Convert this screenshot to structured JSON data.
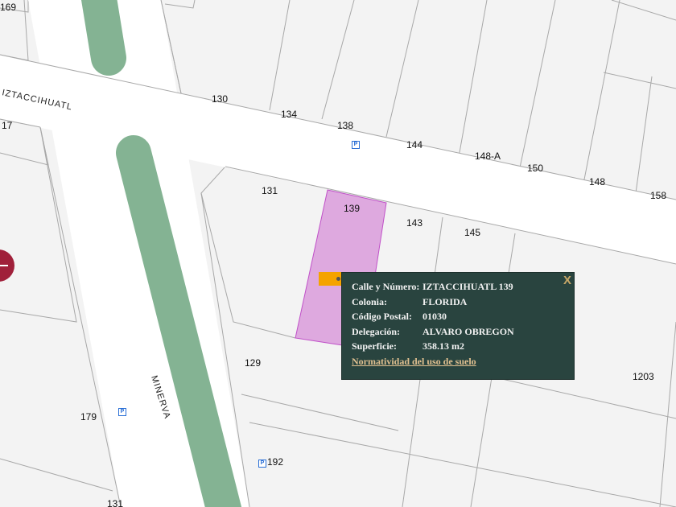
{
  "map": {
    "street_labels": {
      "iztaccihuatl": "IZTACCIHUATL",
      "minerva": "MINERVA"
    },
    "lot_numbers": [
      "169",
      "130",
      "134",
      "138",
      "144",
      "148-A",
      "150",
      "148",
      "158",
      "17",
      "131",
      "139",
      "143",
      "145",
      "129",
      "1203",
      "179",
      "192",
      "131"
    ],
    "selected_lot": "139",
    "colors": {
      "block": "#f3f3f3",
      "road": "#ffffff",
      "median": "#84b393",
      "selected": "#dea9df",
      "popup": "#29443f",
      "marker": "#f5a300"
    }
  },
  "popup": {
    "close_label": "X",
    "rows": [
      {
        "label": "Calle y Número:",
        "value": "IZTACCIHUATL 139"
      },
      {
        "label": "Colonia:",
        "value": "FLORIDA"
      },
      {
        "label": "Código Postal:",
        "value": "01030"
      },
      {
        "label": "Delegación:",
        "value": "ALVARO OBREGON"
      },
      {
        "label": "Superficie:",
        "value": "358.13 m2"
      }
    ],
    "link": "Normatividad del uso de suelo"
  },
  "parking_label": "P"
}
